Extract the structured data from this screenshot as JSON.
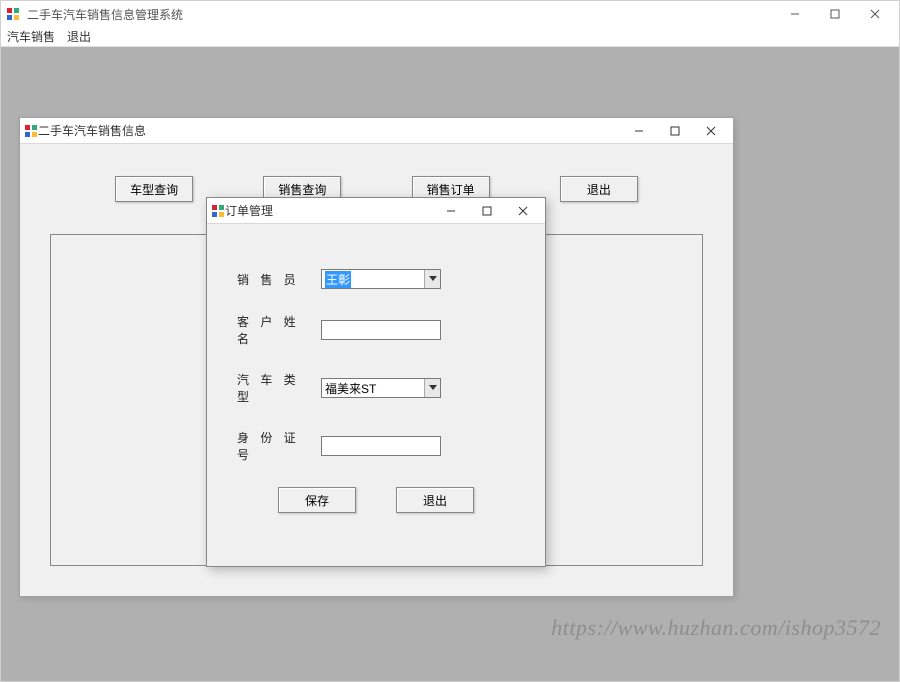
{
  "main": {
    "title": "二手车汽车销售信息管理系统",
    "menu": {
      "item1": "汽车销售",
      "item2": "退出"
    }
  },
  "child1": {
    "title": "二手车汽车销售信息",
    "buttons": {
      "b1": "车型查询",
      "b2": "销售查询",
      "b3": "销售订单",
      "b4": "退出"
    }
  },
  "dialog": {
    "title": "订单管理",
    "labels": {
      "salesperson": "销 售 员",
      "customer": "客 户 姓 名",
      "cartype": "汽 车 类 型",
      "idnum": "身 份 证 号"
    },
    "values": {
      "salesperson": "王彰",
      "customer": "",
      "cartype": "福美来ST",
      "idnum": ""
    },
    "buttons": {
      "save": "保存",
      "exit": "退出"
    }
  },
  "watermark": "https://www.huzhan.com/ishop3572"
}
